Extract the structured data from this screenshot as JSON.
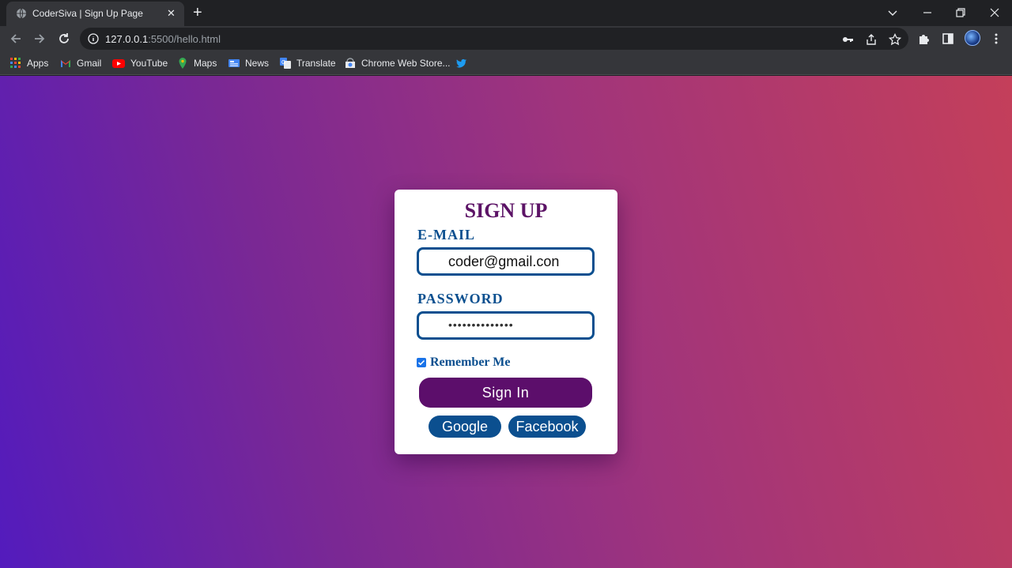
{
  "browser": {
    "tab_title": "CoderSiva | Sign Up Page",
    "tab_close": "✕",
    "new_tab": "+",
    "url_host": "127.0.0.1",
    "url_rest": ":5500/hello.html",
    "bookmarks": [
      {
        "label": "Apps",
        "icon": "apps-grid-icon"
      },
      {
        "label": "Gmail",
        "icon": "gmail-icon"
      },
      {
        "label": "YouTube",
        "icon": "youtube-icon"
      },
      {
        "label": "Maps",
        "icon": "maps-icon"
      },
      {
        "label": "News",
        "icon": "news-icon"
      },
      {
        "label": "Translate",
        "icon": "translate-icon"
      },
      {
        "label": "Chrome Web Store...",
        "icon": "chrome-web-store-icon"
      },
      {
        "label": "",
        "icon": "twitter-icon"
      }
    ]
  },
  "form": {
    "title": "SIGN UP",
    "email_label": "E-MAIL",
    "email_value": "coder@gmail.con",
    "password_label": "PASSWORD",
    "password_masked": "••••••••••••••",
    "remember_label": "Remember Me",
    "remember_checked": true,
    "signin_label": "Sign In",
    "google_label": "Google",
    "facebook_label": "Facebook"
  },
  "colors": {
    "card_title": "#5c1366",
    "label": "#0b4f8f",
    "signin_button": "#5c0e6b",
    "social_button": "#0b4f8f",
    "gradient_start": "#531bbd",
    "gradient_end": "#c43f5a"
  }
}
